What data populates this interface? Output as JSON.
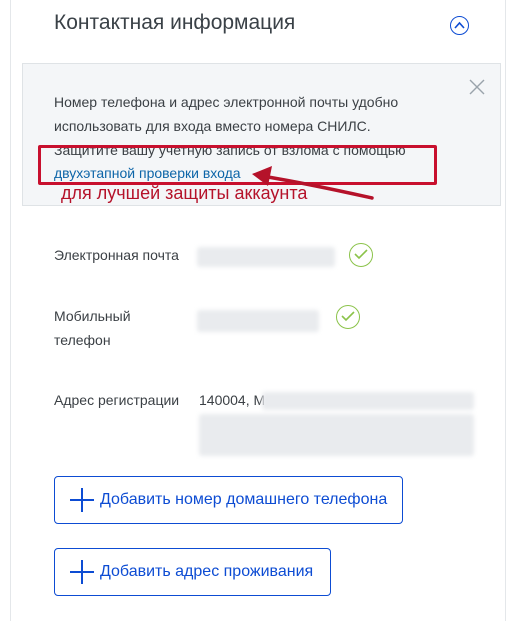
{
  "section": {
    "title": "Контактная информация",
    "collapse_icon": "chevron-up-icon"
  },
  "info_box": {
    "line1": "Номер телефона и адрес электронной почты удобно",
    "line2": "использовать для входа вместо номера СНИЛС.",
    "line3": "Защитите вашу учетную запись от взлома с помощью",
    "link": "двухэтапной проверки входа",
    "close_icon": "close-icon"
  },
  "annotation": {
    "text": "для лучшей защиты аккаунта",
    "color": "#c8102e"
  },
  "fields": {
    "email_label": "Электронная почта",
    "phone_label_line1": "Мобильный",
    "phone_label_line2": "телефон",
    "address_label": "Адрес регистрации",
    "address_visible_fragment": "140004, М",
    "verified_icon": "checkmark-circle-icon"
  },
  "actions": {
    "add_home_phone": "Добавить номер домашнего телефона",
    "add_address": "Добавить адрес проживания"
  },
  "colors": {
    "accent": "#0d4cd3",
    "link": "#0d65a8",
    "verified": "#8bc34a"
  }
}
